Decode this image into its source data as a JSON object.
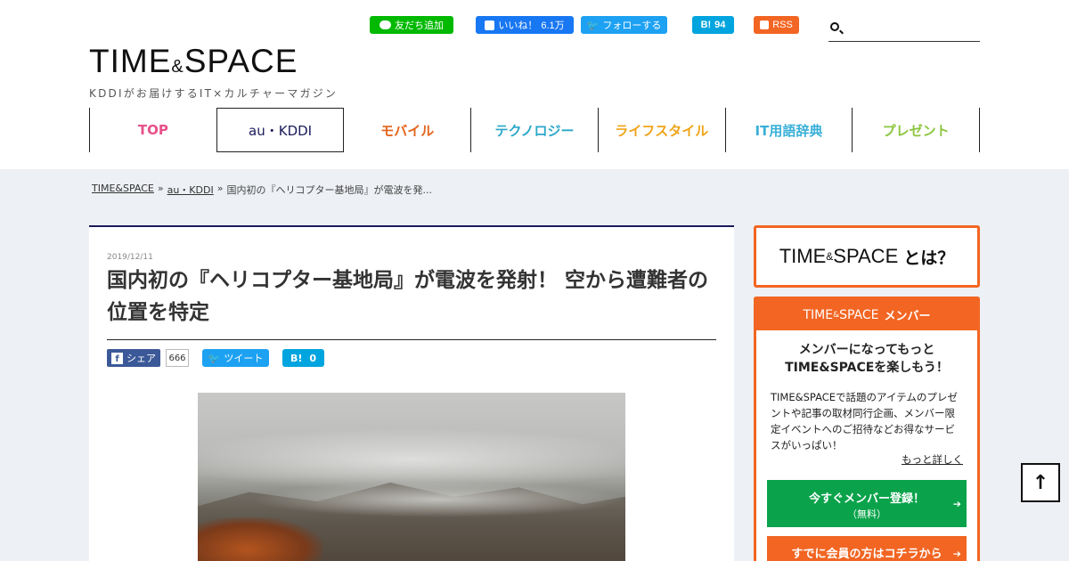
{
  "social": {
    "line": {
      "label": "友だち追加",
      "color": "#00b900"
    },
    "facebook": {
      "label": "いいね！",
      "count": "6.1万",
      "color": "#1877f2"
    },
    "twitter": {
      "label": "フォローする",
      "color": "#1da1f2"
    },
    "hatena": {
      "label": "B!",
      "count": "94",
      "color": "#00a4de"
    },
    "rss": {
      "label": "RSS",
      "color": "#f26522"
    }
  },
  "search": {
    "placeholder": "",
    "icon": "search-icon"
  },
  "logo": {
    "main_left": "TIME",
    "amp": "&",
    "main_right": "SPACE",
    "tagline": "KDDIがお届けするIT×カルチャーマガジン"
  },
  "nav": {
    "items": [
      {
        "label": "TOP",
        "color": "#e8508a"
      },
      {
        "label": "au・KDDI",
        "color": "#1a1a5a"
      },
      {
        "label": "モバイル",
        "color": "#e3641c"
      },
      {
        "label": "テクノロジー",
        "color": "#2aa7c9"
      },
      {
        "label": "ライフスタイル",
        "color": "#f0a418"
      },
      {
        "label": "IT用語辞典",
        "color": "#3ab0d8"
      },
      {
        "label": "プレゼント",
        "color": "#8cc63f"
      }
    ]
  },
  "breadcrumb": {
    "home": "TIME&SPACE",
    "sep": "»",
    "category": "au・KDDI",
    "current": "国内初の『ヘリコプター基地局』が電波を発..."
  },
  "article": {
    "date": "2019/12/11",
    "title": "国内初の『ヘリコプター基地局』が電波を発射！ 空から遭難者の位置を特定",
    "share": {
      "facebook_label": "シェア",
      "facebook_count": "666",
      "twitter_label": "ツイート",
      "hatena_label": "B!",
      "hatena_count": "0"
    }
  },
  "sidebar": {
    "about": {
      "left": "TIME",
      "amp": "&",
      "right": "SPACE",
      "suffix": "とは？"
    },
    "member": {
      "head_left": "TIME",
      "head_amp": "&",
      "head_right": "SPACE",
      "head_suffix": "メンバー",
      "lead_line1": "メンバーになってもっと",
      "lead_line2": "TIME&SPACEを楽しもう！",
      "description": "TIME&SPACEで話題のアイテムのプレゼントや記事の取材同行企画、メンバー限定イベントへのご招待などお得なサービスがいっぱい！",
      "more_link": "もっと詳しく",
      "register_label": "今すぐメンバー登録！",
      "register_note": "（無料）",
      "login_label": "すでに会員の方はコチラから",
      "accent": "#f26522",
      "register_color": "#0aa34b"
    }
  },
  "to_top": {
    "icon": "arrow-up-icon",
    "glyph": "↑"
  }
}
